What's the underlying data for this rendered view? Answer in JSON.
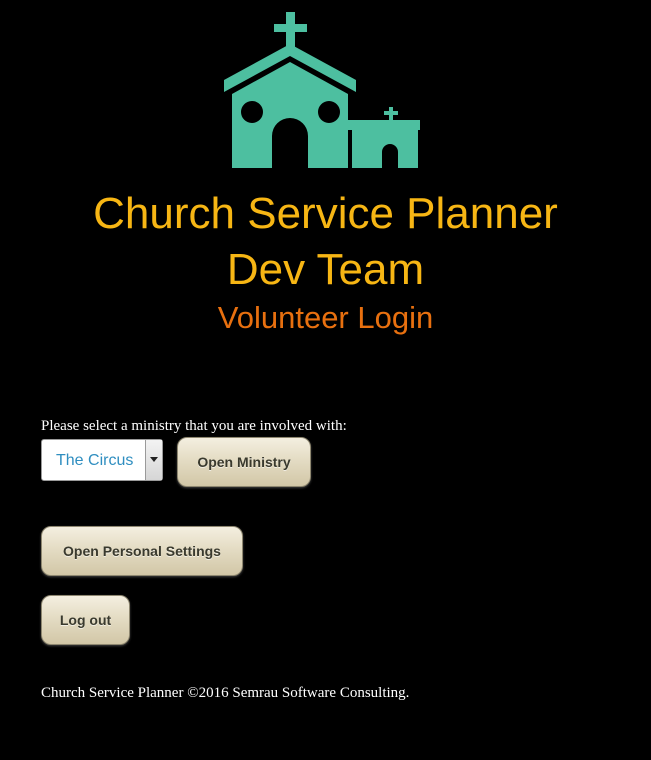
{
  "header": {
    "logo_icon": "church-icon",
    "logo_color": "#4dbfa0",
    "title_line1": "Church Service Planner",
    "title_line2": "Dev Team",
    "subtitle": "Volunteer Login",
    "title_color": "#f7b614",
    "subtitle_color": "#e8700f"
  },
  "ministry": {
    "prompt": "Please select a ministry that you are involved with:",
    "selected": "The Circus",
    "open_button": "Open Ministry"
  },
  "actions": {
    "settings_button": "Open Personal Settings",
    "logout_button": "Log out"
  },
  "footer": {
    "text": "Church Service Planner ©2016 Semrau Software Consulting."
  }
}
